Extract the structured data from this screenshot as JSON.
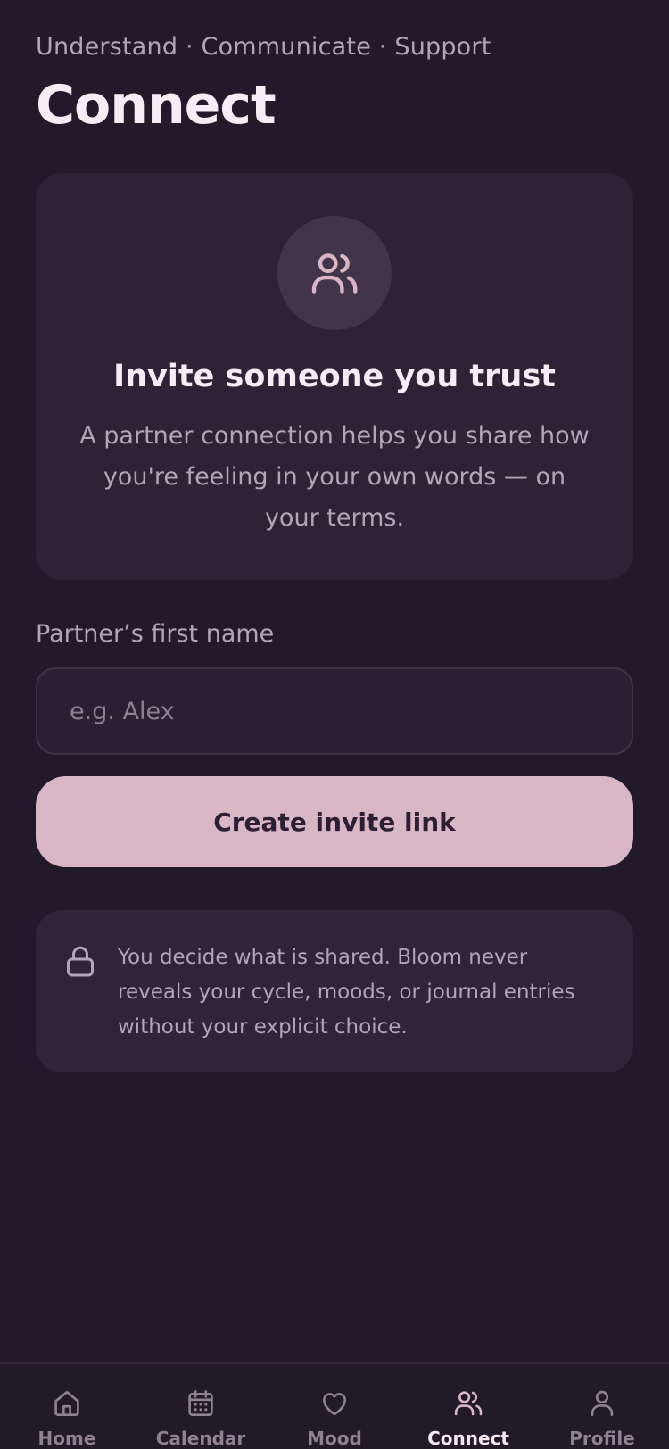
{
  "header": {
    "eyebrow": "Understand · Communicate · Support",
    "title": "Connect"
  },
  "hero": {
    "icon": "people-icon",
    "heading": "Invite someone you trust",
    "body": "A partner connection helps you share how you're feeling in your own words — on your terms."
  },
  "form": {
    "name_label": "Partner’s first name",
    "name_placeholder": "e.g. Alex",
    "name_value": "",
    "submit_label": "Create invite link"
  },
  "privacy": {
    "icon": "lock-icon",
    "text": "You decide what is shared. Bloom never reveals your cycle, moods, or journal entries without your explicit choice."
  },
  "tabbar": {
    "active": "Connect",
    "tabs": [
      {
        "label": "Home",
        "icon": "home-icon"
      },
      {
        "label": "Calendar",
        "icon": "calendar-icon"
      },
      {
        "label": "Mood",
        "icon": "heart-icon"
      },
      {
        "label": "Connect",
        "icon": "people-icon"
      },
      {
        "label": "Profile",
        "icon": "person-icon"
      }
    ]
  },
  "colors": {
    "background": "#221a2b",
    "card": "#2e2236",
    "accent": "#d9b6c3",
    "muted_text": "#b3a4b6",
    "primary_text": "#f6ecf4"
  }
}
